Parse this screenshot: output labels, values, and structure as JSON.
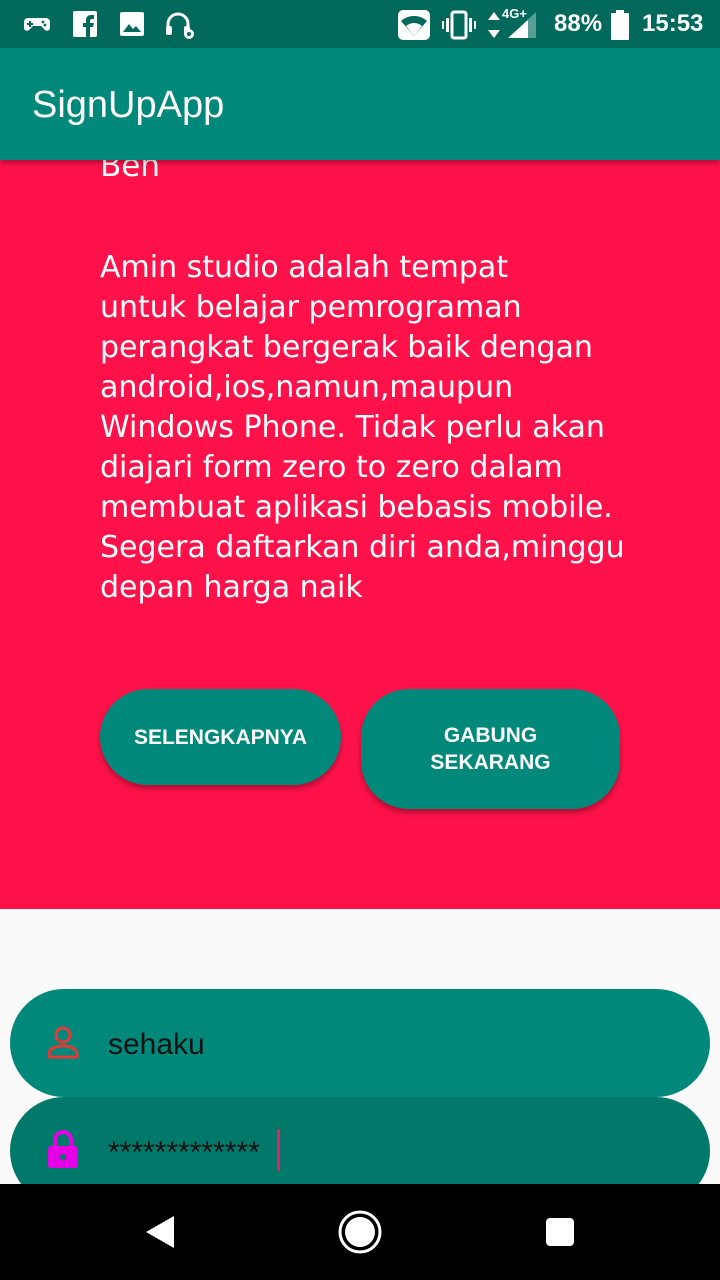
{
  "status_bar": {
    "battery": "88%",
    "time": "15:53",
    "network": "4G+",
    "icons": [
      "game-controller-icon",
      "facebook-icon",
      "image-icon",
      "headset-settings-icon",
      "wifi-icon",
      "vibrate-icon",
      "data-arrows-icon",
      "signal-icon",
      "battery-icon"
    ]
  },
  "app_bar": {
    "title": "SignUpApp"
  },
  "promo": {
    "name": "Ben",
    "description": "Amin studio adalah tempat\nuntuk belajar pemrograman\nperangkat bergerak baik dengan\nandroid,ios,namun,maupun\nWindows Phone. Tidak perlu akan\ndiajari form zero to zero dalam\nmembuat aplikasi bebasis mobile.\nSegera daftarkan diri anda,minggu\ndepan harga naik",
    "more_button": "SELENGKAPNYA",
    "join_button": "GABUNG\nSEKARANG",
    "background_color": "#ff1249",
    "button_color": "#00897b"
  },
  "form": {
    "username_value": "sehaku",
    "password_value": "*************",
    "username_icon": "person-icon",
    "password_icon": "lock-icon"
  },
  "nav_bar": {
    "buttons": [
      "back-icon",
      "home-icon",
      "recents-icon"
    ]
  }
}
